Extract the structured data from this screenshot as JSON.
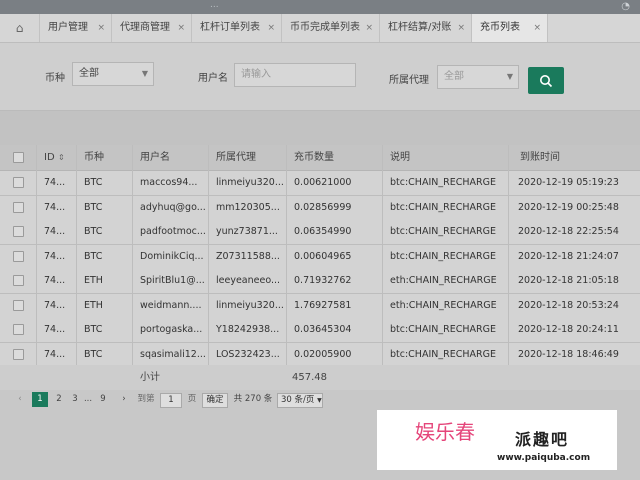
{
  "window": {
    "ghost_title": "..."
  },
  "tabs": [
    {
      "label": "用户管理"
    },
    {
      "label": "代理商管理"
    },
    {
      "label": "杠杆订单列表"
    },
    {
      "label": "币币完成单列表"
    },
    {
      "label": "杠杆结算/对账"
    },
    {
      "label": "充币列表"
    }
  ],
  "filters": {
    "currency_label": "币种",
    "currency_value": "全部",
    "username_label": "用户名",
    "username_placeholder": "请输入",
    "agent_label": "所属代理",
    "agent_value": "全部"
  },
  "table": {
    "columns": [
      "ID",
      "币种",
      "用户名",
      "所属代理",
      "充币数量",
      "说明",
      "到账时间"
    ],
    "rows": [
      {
        "id": "74...",
        "coin": "BTC",
        "user": "maccos94...",
        "agent": "linmeiyu320...",
        "amount": "0.00621000",
        "note": "btc:CHAIN_RECHARGE",
        "time": "2020-12-19 05:19:23"
      },
      {
        "id": "74...",
        "coin": "BTC",
        "user": "adyhuq@go...",
        "agent": "mm120305...",
        "amount": "0.02856999",
        "note": "btc:CHAIN_RECHARGE",
        "time": "2020-12-19 00:25:48"
      },
      {
        "id": "74...",
        "coin": "BTC",
        "user": "padfootmoc...",
        "agent": "yunz73871...",
        "amount": "0.06354990",
        "note": "btc:CHAIN_RECHARGE",
        "time": "2020-12-18 22:25:54"
      },
      {
        "id": "74...",
        "coin": "BTC",
        "user": "DominikCiq...",
        "agent": "Z07311588...",
        "amount": "0.00604965",
        "note": "btc:CHAIN_RECHARGE",
        "time": "2020-12-18 21:24:07"
      },
      {
        "id": "74...",
        "coin": "ETH",
        "user": "SpiritBlu1@...",
        "agent": "leeyeaneeo...",
        "amount": "0.71932762",
        "note": "eth:CHAIN_RECHARGE",
        "time": "2020-12-18 21:05:18"
      },
      {
        "id": "74...",
        "coin": "ETH",
        "user": "weidmann....",
        "agent": "linmeiyu320...",
        "amount": "1.76927581",
        "note": "eth:CHAIN_RECHARGE",
        "time": "2020-12-18 20:53:24"
      },
      {
        "id": "74...",
        "coin": "BTC",
        "user": "portogaska...",
        "agent": "Y18242938...",
        "amount": "0.03645304",
        "note": "btc:CHAIN_RECHARGE",
        "time": "2020-12-18 20:24:11"
      },
      {
        "id": "74...",
        "coin": "BTC",
        "user": "sqasimali12...",
        "agent": "LOS232423...",
        "amount": "0.02005900",
        "note": "btc:CHAIN_RECHARGE",
        "time": "2020-12-18 18:46:49"
      }
    ],
    "subtotal_label": "小计",
    "subtotal_value": "457.48"
  },
  "pagination": {
    "pages": [
      "1",
      "2",
      "3",
      "...",
      "9"
    ],
    "goto_label": "到第",
    "goto_value": "1",
    "page_unit": "页",
    "confirm_label": "确定",
    "total_text": "共 270 条",
    "page_size": "30 条/页"
  },
  "watermark": {
    "brand_left": "娱乐春",
    "brand_right": "派趣吧",
    "url": "www.paiquba.com"
  },
  "colors": {
    "accent": "#1a7a5c"
  }
}
